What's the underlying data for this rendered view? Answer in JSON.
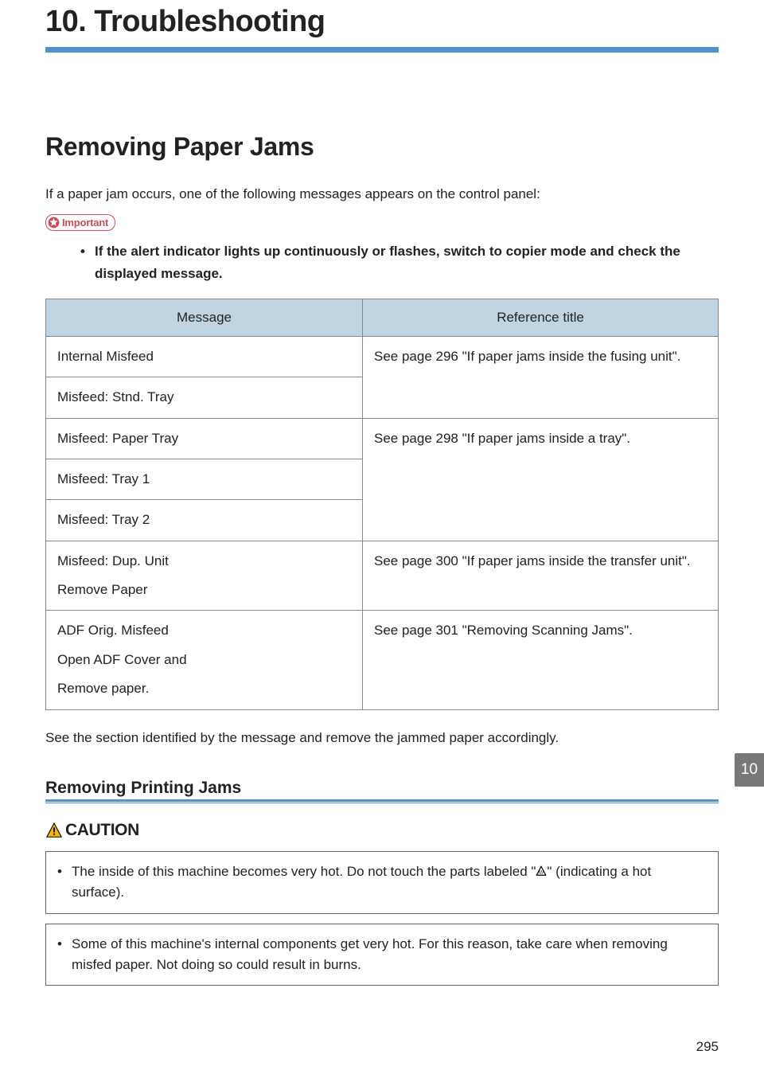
{
  "chapter": {
    "title": "10. Troubleshooting"
  },
  "section": {
    "title": "Removing Paper Jams",
    "intro": "If a paper jam occurs, one of the following messages appears on the control panel:"
  },
  "important": {
    "label": "Important",
    "bullet": "If the alert indicator lights up continuously or flashes, switch to copier mode and check the displayed message."
  },
  "table": {
    "header_message": "Message",
    "header_reference": "Reference title",
    "ref_fusing": "See page 296 \"If paper jams inside the fusing unit\".",
    "ref_tray": "See page 298 \"If paper jams inside a tray\".",
    "ref_transfer": "See page 300 \"If paper jams inside the transfer unit\".",
    "ref_scanning": "See page 301 \"Removing Scanning Jams\".",
    "msg_internal": "Internal Misfeed",
    "msg_stnd": "Misfeed: Stnd. Tray",
    "msg_paper_tray": "Misfeed: Paper Tray",
    "msg_tray1": "Misfeed: Tray 1",
    "msg_tray2": "Misfeed: Tray 2",
    "msg_dup_1": "Misfeed: Dup. Unit",
    "msg_dup_2": "Remove Paper",
    "msg_adf_1": "ADF Orig. Misfeed",
    "msg_adf_2": "Open ADF Cover and",
    "msg_adf_3": "Remove paper."
  },
  "after_table": "See the section identified by the message and remove the jammed paper accordingly.",
  "thumb_tab": "10",
  "subsection": {
    "title": "Removing Printing Jams"
  },
  "caution": {
    "label": "CAUTION",
    "box1_pre": "The inside of this machine becomes very hot. Do not touch the parts labeled \"",
    "box1_post": "\" (indicating a hot surface).",
    "box2": "Some of this machine's internal components get very hot. For this reason, take care when removing misfed paper. Not doing so could result in burns."
  },
  "page_number": "295"
}
